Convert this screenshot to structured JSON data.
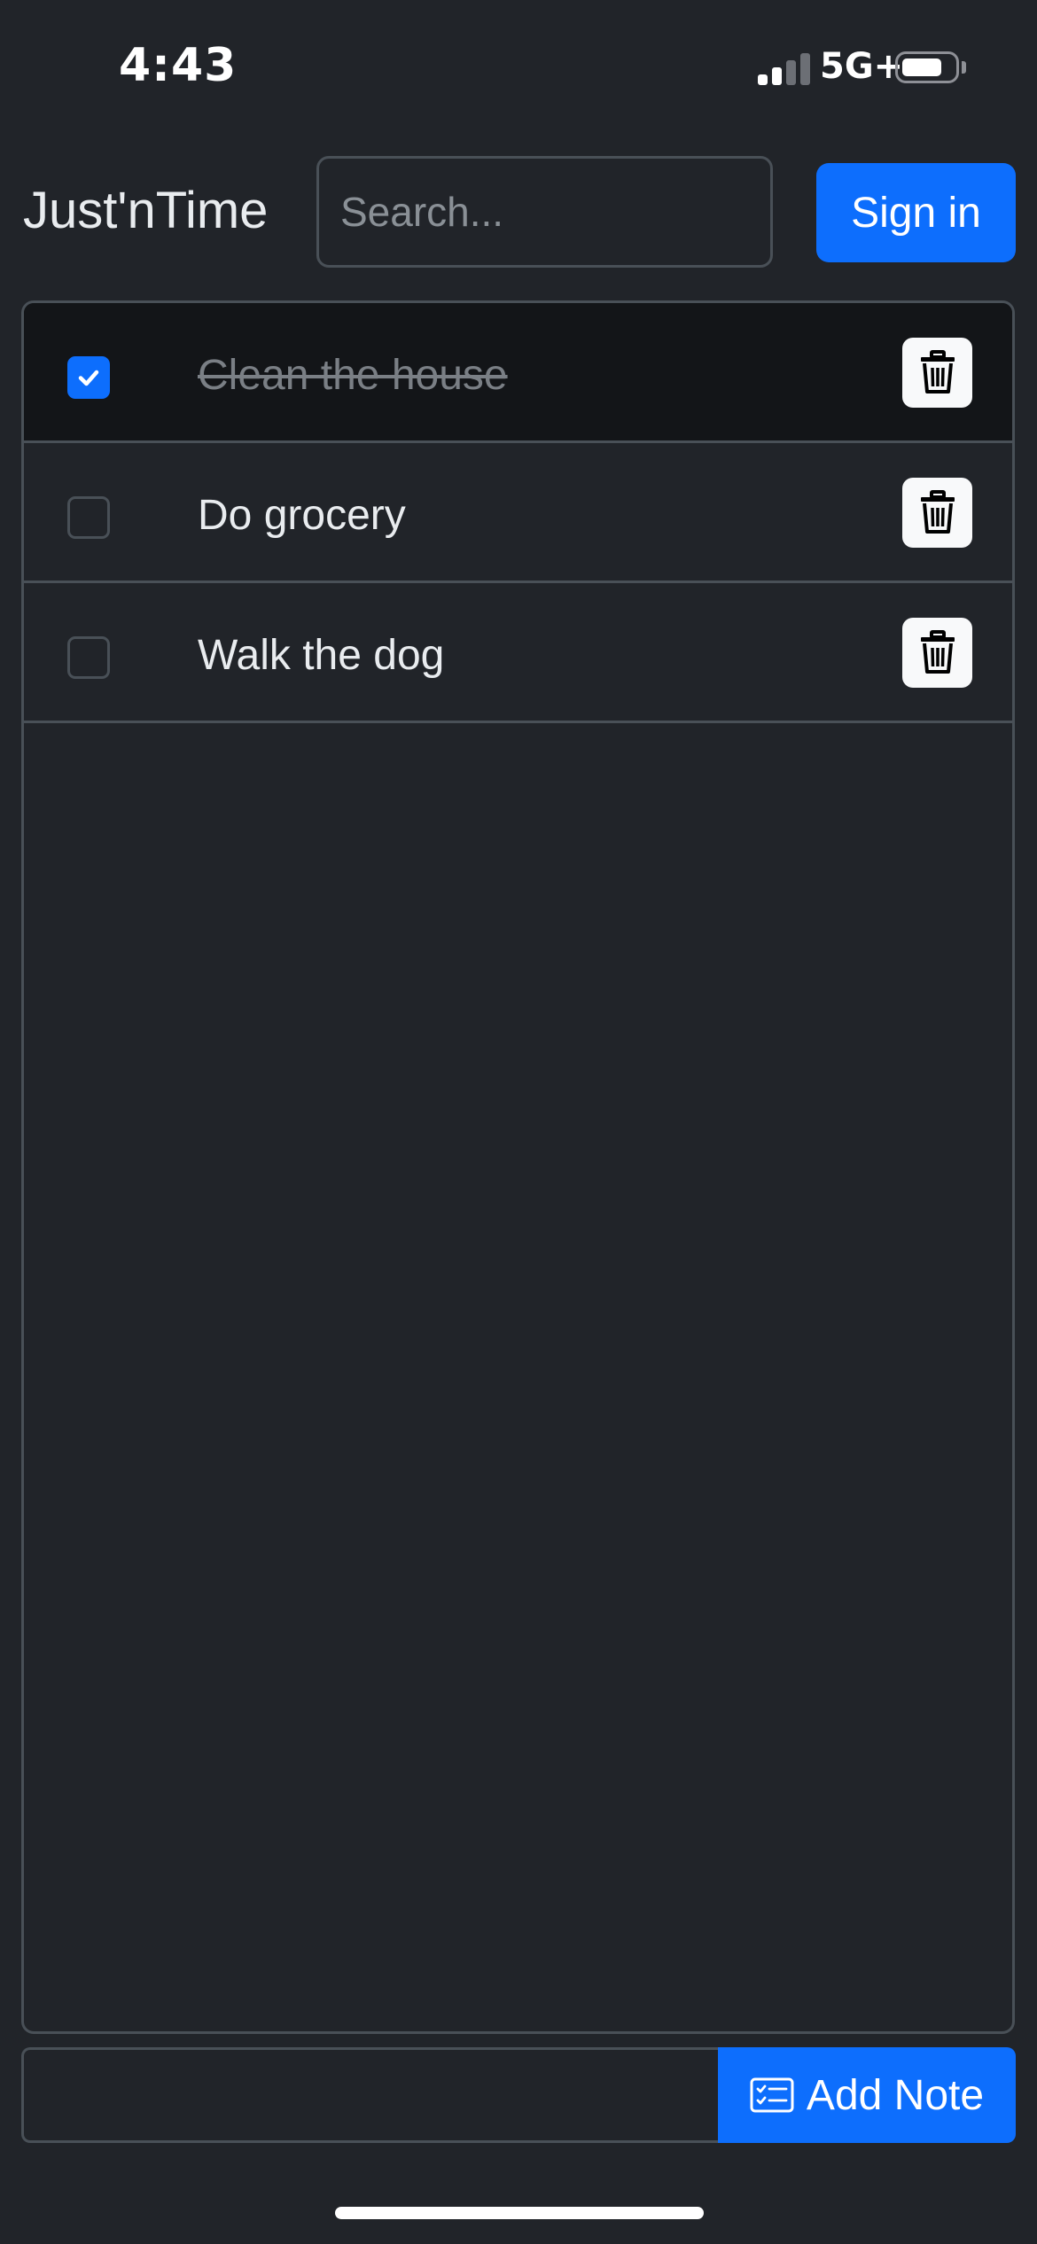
{
  "status_bar": {
    "time": "4:43",
    "network": "5G+"
  },
  "header": {
    "brand": "Just'nTime",
    "search": {
      "placeholder": "Search...",
      "value": ""
    },
    "signin_label": "Sign in"
  },
  "todos": [
    {
      "text": "Clean the house",
      "checked": true
    },
    {
      "text": "Do grocery",
      "checked": false
    },
    {
      "text": "Walk the dog",
      "checked": false
    }
  ],
  "footer": {
    "note_input": {
      "value": "",
      "placeholder": ""
    },
    "add_note_label": "Add Note"
  },
  "icons": {
    "checkbox_checked": "check-icon",
    "delete": "trash-icon",
    "add_note": "checklist-card-icon"
  },
  "colors": {
    "background": "#212429",
    "accent": "#0d6efd",
    "border": "#495057",
    "completed_row": "#131518"
  }
}
